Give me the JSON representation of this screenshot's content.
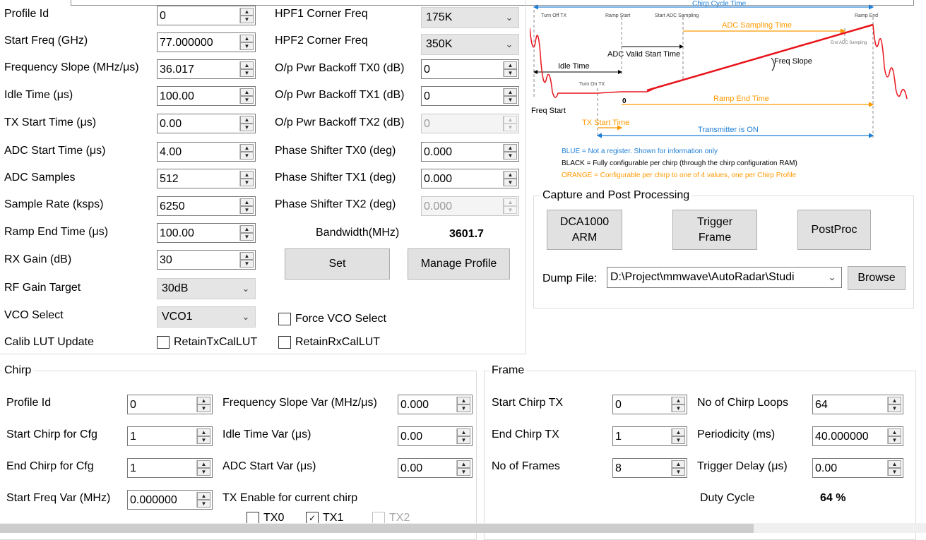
{
  "profile": {
    "fields": [
      {
        "label": "Profile Id",
        "value": "0"
      },
      {
        "label": "Start Freq (GHz)",
        "value": "77.000000"
      },
      {
        "label": "Frequency Slope (MHz/μs)",
        "value": "36.017"
      },
      {
        "label": "Idle Time (μs)",
        "value": "100.00"
      },
      {
        "label": "TX Start Time (μs)",
        "value": "0.00"
      },
      {
        "label": "ADC Start Time (μs)",
        "value": "4.00"
      },
      {
        "label": "ADC Samples",
        "value": "512"
      },
      {
        "label": "Sample Rate (ksps)",
        "value": "6250"
      },
      {
        "label": "Ramp End Time (μs)",
        "value": "100.00"
      },
      {
        "label": "RX Gain (dB)",
        "value": "30"
      }
    ],
    "rf_gain_target": {
      "label": "RF Gain Target",
      "value": "30dB"
    },
    "vco_select": {
      "label": "VCO Select",
      "value": "VCO1"
    },
    "calib_lut_label": "Calib LUT Update",
    "retain_tx": "RetainTxCalLUT",
    "retain_rx": "RetainRxCalLUT",
    "hpf1": {
      "label": "HPF1 Corner Freq",
      "value": "175K"
    },
    "hpf2": {
      "label": "HPF2 Corner Freq",
      "value": "350K"
    },
    "right_fields": [
      {
        "label": "O/p Pwr Backoff TX0 (dB)",
        "value": "0"
      },
      {
        "label": "O/p Pwr Backoff TX1 (dB)",
        "value": "0"
      },
      {
        "label": "O/p Pwr Backoff TX2 (dB)",
        "value": "0"
      },
      {
        "label": "Phase Shifter TX0 (deg)",
        "value": "0.000"
      },
      {
        "label": "Phase Shifter TX1 (deg)",
        "value": "0.000"
      },
      {
        "label": "Phase Shifter TX2 (deg)",
        "value": "0.000"
      }
    ],
    "bandwidth_label": "Bandwidth(MHz)",
    "bandwidth_value": "3601.7",
    "set_button": "Set",
    "manage_button": "Manage Profile",
    "force_vco": "Force VCO Select"
  },
  "diagram": {
    "chirp_cycle": "Chirp Cycle Time",
    "turn_off_tx": "Turn Off TX",
    "ramp_start": "Ramp Start",
    "start_adc": "Start ADC Sampling",
    "ramp_end": "Ramp End",
    "adc_sampling_time": "ADC Sampling Time",
    "end_adc": "End ADC Sampling",
    "adc_valid": "ADC Valid Start Time",
    "freq_slope": "Freq Slope",
    "idle_time": "Idle Time",
    "turn_on_tx": "Turn On TX",
    "zero": "0",
    "ramp_end_time": "Ramp End Time",
    "freq_start": "Freq Start",
    "tx_start_time": "TX Start Time",
    "transmitter_on": "Transmitter is ON",
    "legend_blue": "BLUE = Not a register. Shown for information only",
    "legend_black": "BLACK = Fully configurable per chirp (through the chirp configuration RAM)",
    "legend_orange": "ORANGE = Configurable per chirp to one of 4 values, one per Chirp Profile",
    "colors": {
      "blue": "#1e7fd6",
      "orange": "#ff9900",
      "red": "#e8141b"
    }
  },
  "capture": {
    "title": "Capture and Post Processing",
    "dca_button": "DCA1000 ARM",
    "trigger_button": "Trigger Frame",
    "postproc_button": "PostProc",
    "dump_label": "Dump File:",
    "dump_value": "D:\\Project\\mmwave\\AutoRadar\\Studi",
    "browse_button": "Browse"
  },
  "chirp": {
    "title": "Chirp",
    "left": [
      {
        "label": "Profile Id",
        "value": "0"
      },
      {
        "label": "Start Chirp for Cfg",
        "value": "1"
      },
      {
        "label": "End Chirp for Cfg",
        "value": "1"
      },
      {
        "label": "Start Freq Var (MHz)",
        "value": "0.000000"
      }
    ],
    "right": [
      {
        "label": "Frequency Slope Var (MHz/μs)",
        "value": "0.000"
      },
      {
        "label": "Idle Time Var (μs)",
        "value": "0.00"
      },
      {
        "label": "ADC Start Var (μs)",
        "value": "0.00"
      }
    ],
    "tx_enable_label": "TX Enable for current chirp",
    "tx0": "TX0",
    "tx1": "TX1",
    "tx2": "TX2"
  },
  "frame": {
    "title": "Frame",
    "left": [
      {
        "label": "Start Chirp TX",
        "value": "0"
      },
      {
        "label": "End Chirp TX",
        "value": "1"
      },
      {
        "label": "No of Frames",
        "value": "8"
      }
    ],
    "right": [
      {
        "label": "No of Chirp Loops",
        "value": "64"
      },
      {
        "label": "Periodicity (ms)",
        "value": "40.000000"
      },
      {
        "label": "Trigger Delay (μs)",
        "value": "0.00"
      }
    ],
    "duty_label": "Duty Cycle",
    "duty_value": "64 %"
  }
}
